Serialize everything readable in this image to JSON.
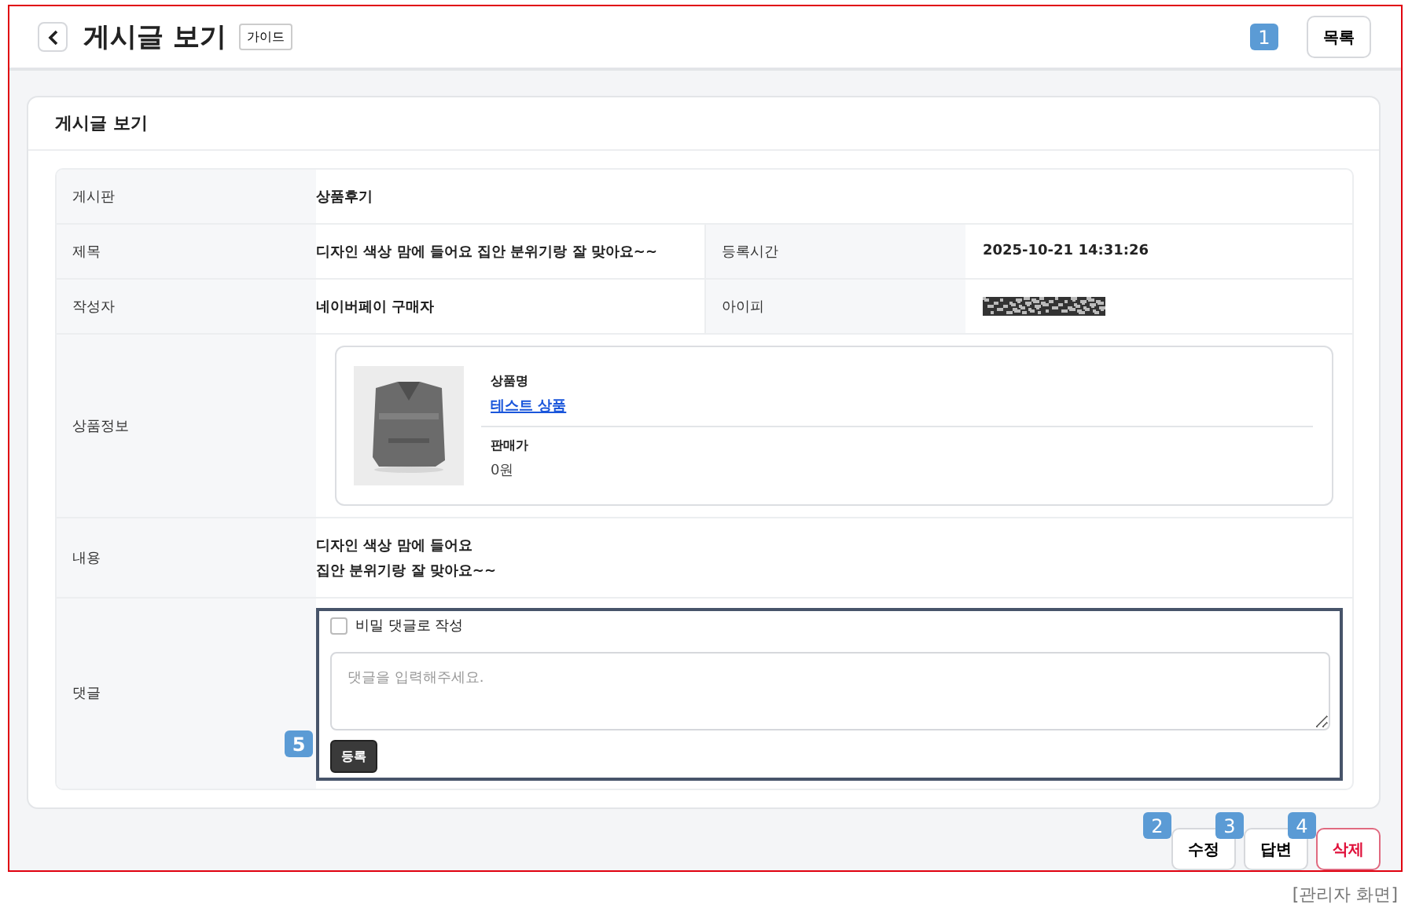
{
  "header": {
    "title": "게시글 보기",
    "guide_button": "가이드",
    "list_button": "목록",
    "list_marker": "1"
  },
  "card": {
    "title": "게시글 보기"
  },
  "rows": [
    {
      "kind": "single",
      "label": "게시판",
      "value": "상품후기"
    },
    {
      "kind": "pair",
      "label": "제목",
      "value": "디자인 색상 맘에 들어요 집안 분위기랑 잘 맞아요~~",
      "label_2": "등록시간",
      "value_2": "2025-10-21 14:31:26"
    },
    {
      "kind": "pair",
      "label": "작성자",
      "value": "네이버페이 구매자",
      "label_2": "아이피",
      "redacted_2": true
    },
    {
      "kind": "product",
      "label": "상품정보",
      "name_label": "상품명",
      "name": "테스트 상품",
      "price_label": "판매가",
      "price": "0원"
    },
    {
      "kind": "content",
      "label": "내용",
      "lines": [
        "디자인 색상 맘에 들어요",
        "집안 분위기랑 잘 맞아요~~"
      ]
    },
    {
      "kind": "comment",
      "label": "댓글",
      "secret_label": "비밀 댓글로 작성",
      "checked": false,
      "placeholder": "댓글을 입력해주세요.",
      "submit": "등록",
      "marker": "5"
    }
  ],
  "buttons": [
    {
      "label": "수정",
      "kind": "normal",
      "marker": "2"
    },
    {
      "label": "답변",
      "kind": "normal",
      "marker": "3"
    },
    {
      "label": "삭제",
      "kind": "danger",
      "marker": "4"
    }
  ],
  "caption": "[관리자 화면]"
}
